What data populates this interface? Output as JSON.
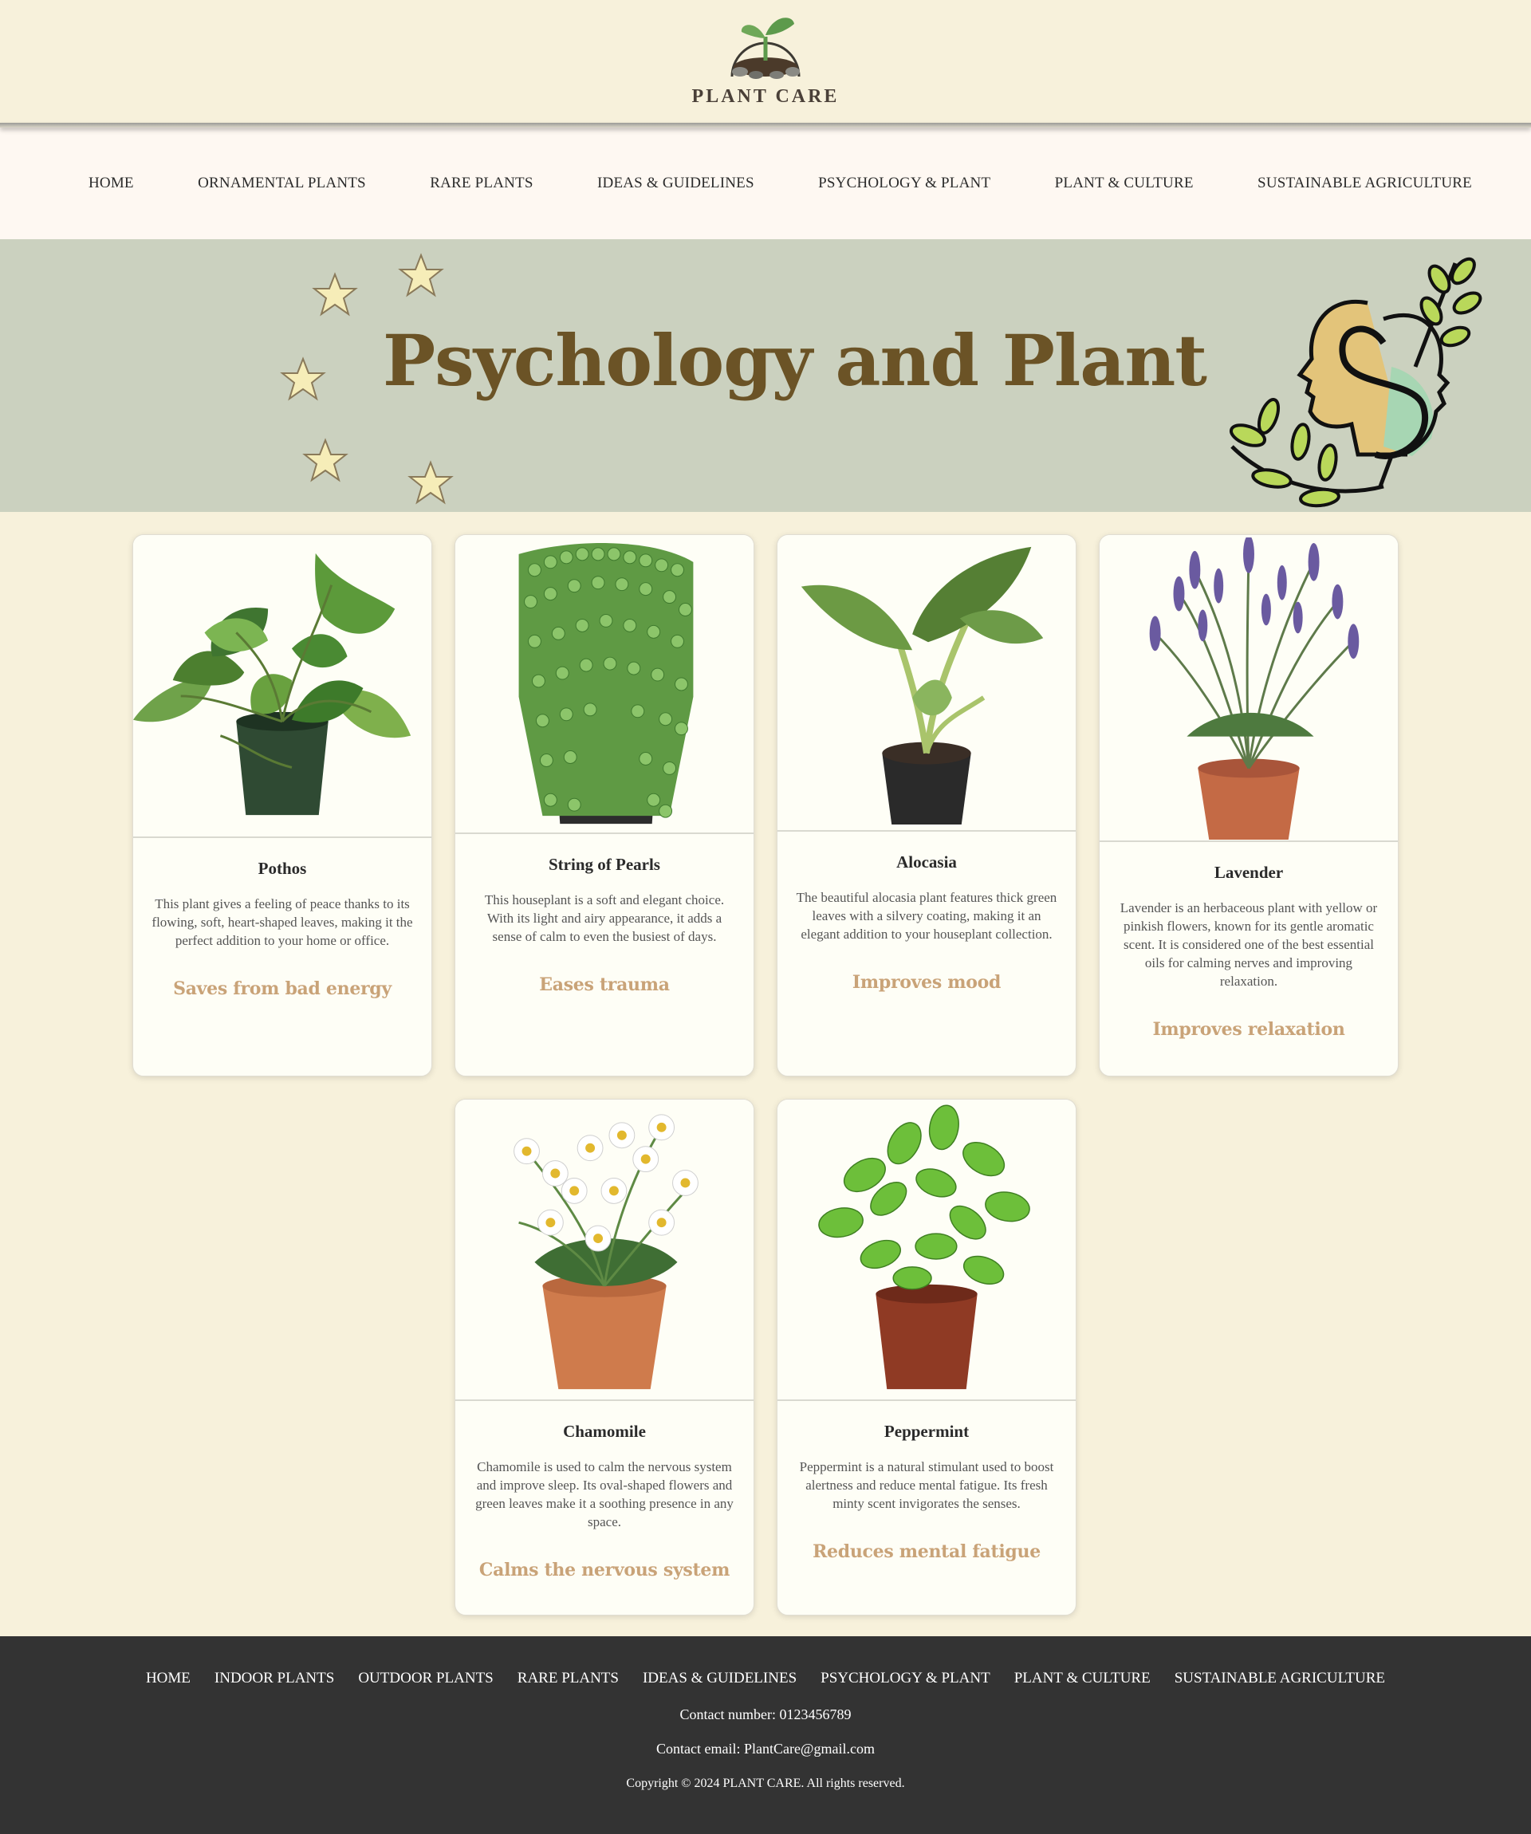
{
  "brand": {
    "name": "PLANT CARE",
    "logo_icon": "sprout-logo-icon"
  },
  "nav": {
    "items": [
      {
        "label": "HOME"
      },
      {
        "label": "ORNAMENTAL PLANTS"
      },
      {
        "label": "RARE PLANTS"
      },
      {
        "label": "IDEAS & GUIDELINES"
      },
      {
        "label": "PSYCHOLOGY & PLANT"
      },
      {
        "label": "PLANT & CULTURE"
      },
      {
        "label": "SUSTAINABLE AGRICULTURE"
      }
    ]
  },
  "banner": {
    "title": "Psychology and Plant",
    "decor": [
      "star-icon",
      "head-leaves-illustration"
    ]
  },
  "cards": [
    {
      "name": "Pothos",
      "description": "This plant gives a feeling of peace thanks to its flowing, soft, heart-shaped leaves, making it the perfect addition to your home or office.",
      "benefit": "Saves from bad energy",
      "image": "pothos-image"
    },
    {
      "name": "String of Pearls",
      "description": "This houseplant is a soft and elegant choice. With its light and airy appearance, it adds a sense of calm to even the busiest of days.",
      "benefit": "Eases trauma",
      "image": "string-of-pearls-image"
    },
    {
      "name": "Alocasia",
      "description": "The beautiful alocasia plant features thick green leaves with a silvery coating, making it an elegant addition to your houseplant collection.",
      "benefit": "Improves mood",
      "image": "alocasia-image"
    },
    {
      "name": "Lavender",
      "description": "Lavender is an herbaceous plant with yellow or pinkish flowers, known for its gentle aromatic scent. It is considered one of the best essential oils for calming nerves and improving relaxation.",
      "benefit": "Improves relaxation",
      "image": "lavender-image"
    },
    {
      "name": "Chamomile",
      "description": "Chamomile is used to calm the nervous system and improve sleep. Its oval-shaped flowers and green leaves make it a soothing presence in any space.",
      "benefit": "Calms the nervous system",
      "image": "chamomile-image"
    },
    {
      "name": "Peppermint",
      "description": "Peppermint is a natural stimulant used to boost alertness and reduce mental fatigue. Its fresh minty scent invigorates the senses.",
      "benefit": "Reduces mental fatigue",
      "image": "peppermint-image"
    }
  ],
  "footer": {
    "nav": [
      {
        "label": "HOME"
      },
      {
        "label": "INDOOR PLANTS"
      },
      {
        "label": "OUTDOOR PLANTS"
      },
      {
        "label": "RARE PLANTS"
      },
      {
        "label": "IDEAS & GUIDELINES"
      },
      {
        "label": "PSYCHOLOGY & PLANT"
      },
      {
        "label": "PLANT & CULTURE"
      },
      {
        "label": "SUSTAINABLE AGRICULTURE"
      }
    ],
    "contact_number": "Contact number: 0123456789",
    "contact_email": "Contact email: PlantCare@gmail.com",
    "copyright": "Copyright © 2024 PLANT CARE. All rights reserved."
  },
  "colors": {
    "page_bg": "#f7f1db",
    "nav_bg": "#fef8f2",
    "banner_bg": "#cbd1bf",
    "banner_title": "#6b5326",
    "benefit_text": "#c9a378",
    "footer_bg": "#333333"
  }
}
